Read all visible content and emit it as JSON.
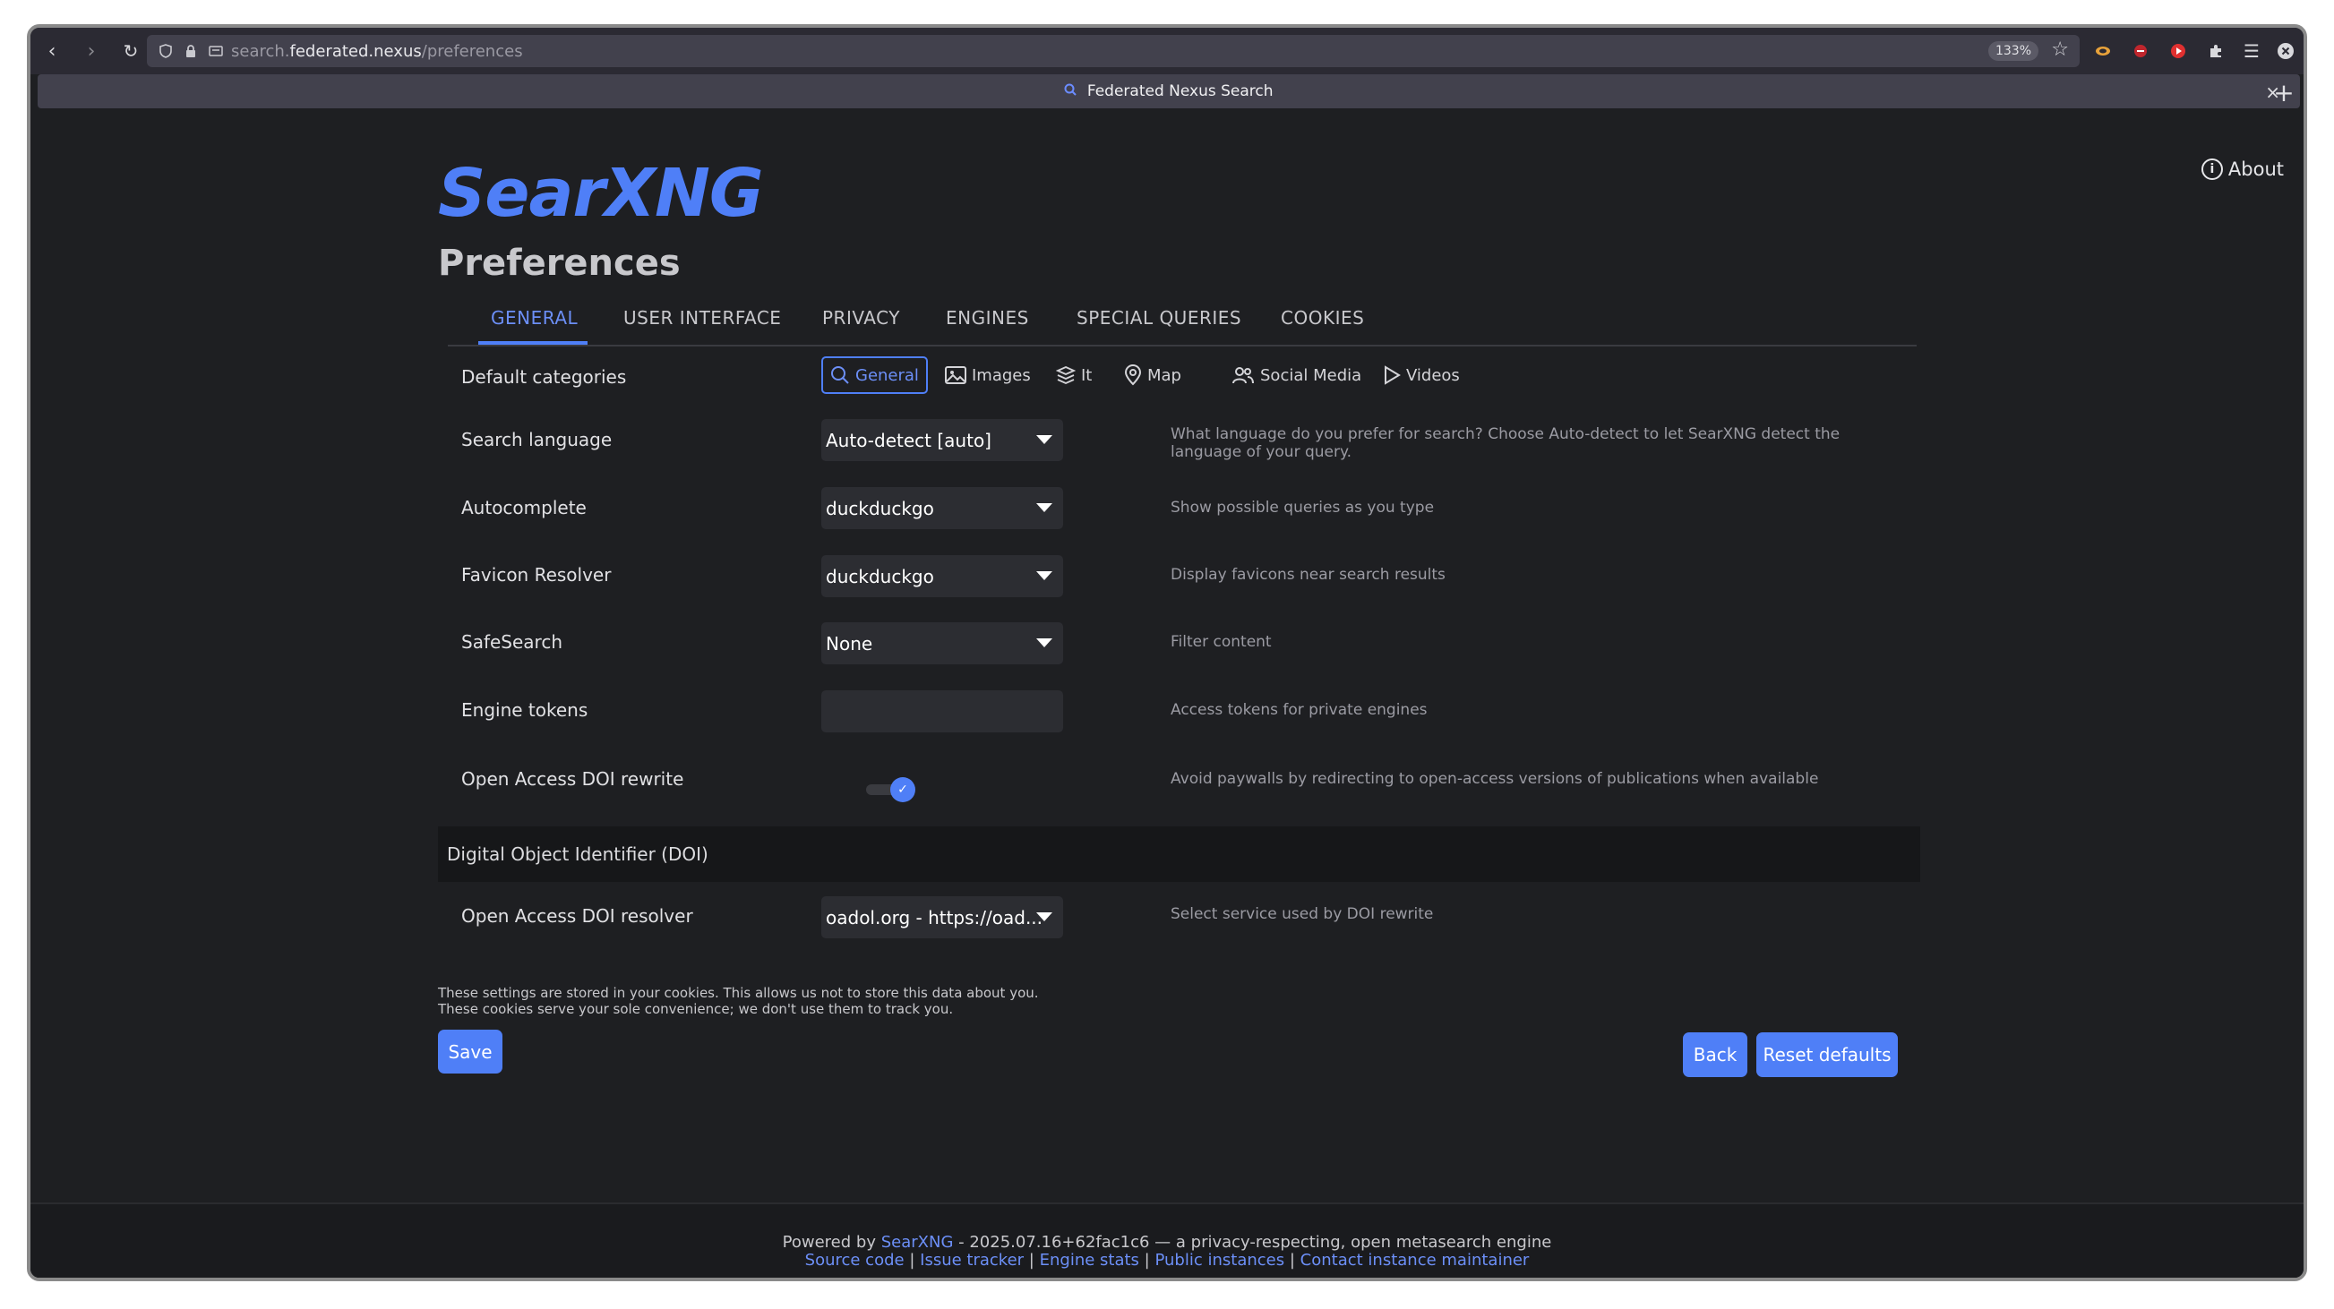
{
  "browser": {
    "url_prefix": "search.",
    "url_host": "federated.nexus",
    "url_path": "/preferences",
    "zoom": "133%",
    "tab_title": "Federated Nexus Search"
  },
  "header": {
    "logo": "SearXNG",
    "about": "About",
    "page_title": "Preferences"
  },
  "tabs": [
    "GENERAL",
    "USER INTERFACE",
    "PRIVACY",
    "ENGINES",
    "SPECIAL QUERIES",
    "COOKIES"
  ],
  "general": {
    "default_categories_label": "Default categories",
    "categories": [
      "General",
      "Images",
      "It",
      "Map",
      "Social Media",
      "Videos"
    ],
    "search_language": {
      "label": "Search language",
      "value": "Auto-detect [auto]",
      "desc": "What language do you prefer for search? Choose Auto-detect to let SearXNG detect the language of your query."
    },
    "autocomplete": {
      "label": "Autocomplete",
      "value": "duckduckgo",
      "desc": "Show possible queries as you type"
    },
    "favicon": {
      "label": "Favicon Resolver",
      "value": "duckduckgo",
      "desc": "Display favicons near search results"
    },
    "safesearch": {
      "label": "SafeSearch",
      "value": "None",
      "desc": "Filter content"
    },
    "engine_tokens": {
      "label": "Engine tokens",
      "value": "",
      "desc": "Access tokens for private engines"
    },
    "doi_rewrite": {
      "label": "Open Access DOI rewrite",
      "enabled": true,
      "desc": "Avoid paywalls by redirecting to open-access versions of publications when available"
    }
  },
  "doi_section": {
    "title": "Digital Object Identifier (DOI)",
    "resolver": {
      "label": "Open Access DOI resolver",
      "value": "oadol.org - https://oad...",
      "desc": "Select service used by DOI rewrite"
    }
  },
  "note": {
    "line1": "These settings are stored in your cookies. This allows us not to store this data about you.",
    "line2": "These cookies serve your sole convenience; we don't use them to track you."
  },
  "buttons": {
    "save": "Save",
    "back": "Back",
    "reset": "Reset defaults"
  },
  "footer": {
    "powered_by": "Powered by",
    "searxng_link": "SearXNG",
    "version_text": " - 2025.07.16+62fac1c6 — a privacy-respecting, open metasearch engine",
    "links": [
      "Source code",
      "Issue tracker",
      "Engine stats",
      "Public instances",
      "Contact instance maintainer"
    ]
  },
  "colors": {
    "accent": "#4f7ff7",
    "background": "#1e1f22"
  }
}
